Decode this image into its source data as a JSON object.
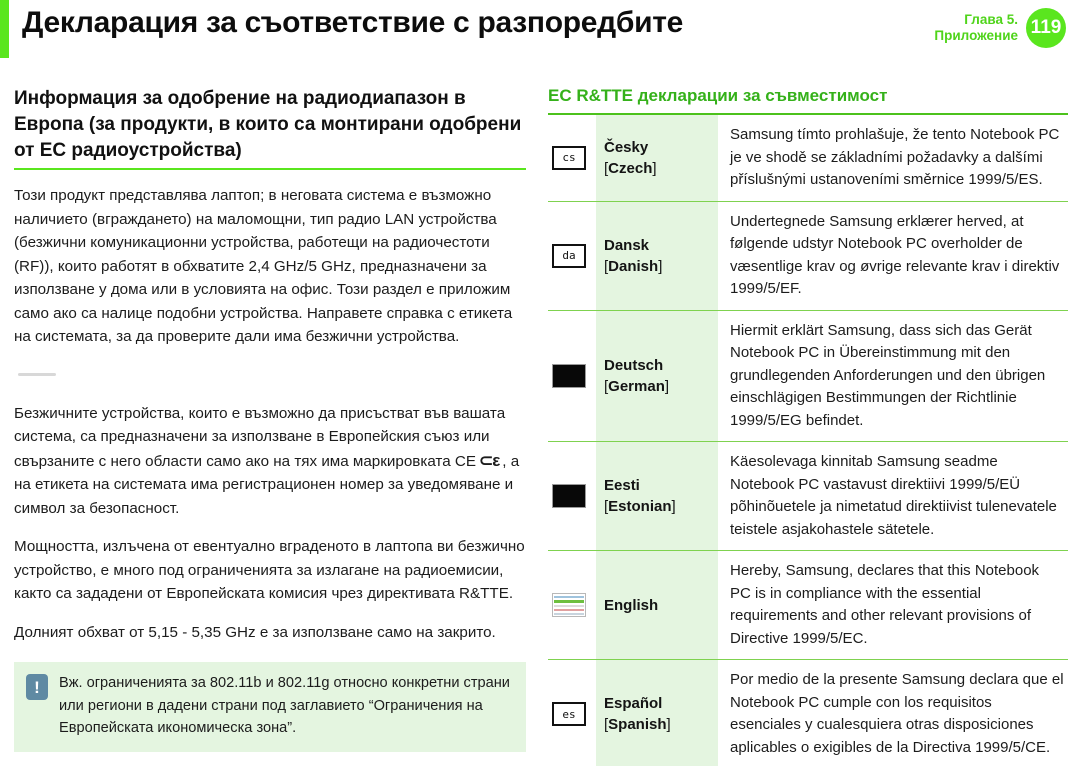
{
  "header": {
    "title": "Декларация за съответствие с разпоредбите",
    "chapter_line1": "Глава 5.",
    "chapter_line2": "Приложение",
    "page_number": "119",
    "accent_color": "#5ae61e"
  },
  "left": {
    "heading": "Информация за одобрение на радиодиапазон в Европа (за продукти, в които са монтирани одобрени от ЕС радиоустройства)",
    "p1": "Този продукт представлява лаптоп; в неговата система е възможно наличието (вграждането) на маломощни, тип радио LAN устройства (безжични комуникационни устройства, работещи на радиочестоти (RF)), които работят в обхватите 2,4 GHz/5 GHz, предназначени за използване у дома или в условията на офис. Този раздел е приложим само ако са налице подобни устройства. Направете справка с етикета на системата, за да проверите дали има безжични устройства.",
    "p2_before_ce": "Безжичните устройства, които е възможно да присъстват във вашата система, са предназначени за използване в Европейския съюз или свързаните с него области само ако на тях има маркировката CE",
    "ce_symbol": "CE",
    "p2_after_ce": ", а на етикета на системата има регистрационен номер за уведомяване и символ за безопасност.",
    "p3": "Мощността, излъчена от евентуално вграденото в лаптопа ви безжично устройство, е много под ограниченията за излагане на радиоемисии, както са зададени от Европейската комисия чрез директивата R&TTE.",
    "p4": "Долният обхват от 5,15 - 5,35 GHz е за използване само на закрито.",
    "note": {
      "icon": "!",
      "text": "Вж. ограниченията за 802.11b и 802.11g относно конкретни страни или региони в дадени страни под заглавието “Ограничения на Европейската икономическа зона”."
    }
  },
  "right": {
    "heading": "EC R&TTE декларации за съвместимост",
    "heading_color": "#35b11a",
    "rows": [
      {
        "flag_kind": "code",
        "flag_code": "cs",
        "flag_icon_name": "flag-icon-czech",
        "native": "Česky",
        "bracket_open": "[",
        "bracket_name": "Czech",
        "bracket_close": "]",
        "declaration": "Samsung tímto prohlašuje, že tento Notebook PC je ve shodě se základními požadavky a dalšími příslušnými ustanoveními směrnice 1999/5/ES."
      },
      {
        "flag_kind": "code",
        "flag_code": "da",
        "flag_icon_name": "flag-icon-danish",
        "native": "Dansk",
        "bracket_open": "[",
        "bracket_name": "Danish",
        "bracket_close": "]",
        "declaration": "Undertegnede Samsung erklærer herved, at følgende udstyr Notebook PC overholder de væsentlige krav og øvrige relevante krav i direktiv 1999/5/EF."
      },
      {
        "flag_kind": "dark",
        "flag_code": "",
        "flag_icon_name": "flag-icon-german",
        "native": "Deutsch",
        "bracket_open": "[",
        "bracket_name": "German",
        "bracket_close": "]",
        "declaration": "Hiermit erklärt Samsung, dass sich das Gerät Notebook PC in Übereinstimmung mit den grundlegenden Anforderungen und den übrigen einschlägigen Bestimmungen der Richtlinie 1999/5/EG befindet."
      },
      {
        "flag_kind": "dark",
        "flag_code": "",
        "flag_icon_name": "flag-icon-estonian",
        "native": "Eesti",
        "bracket_open": "[",
        "bracket_name": "Estonian",
        "bracket_close": "]",
        "declaration": "Käesolevaga kinnitab Samsung seadme Notebook PC vastavust direktiivi 1999/5/EÜ põhinõuetele ja nimetatud direktiivist tulenevatele teistele asjakohastele sätetele."
      },
      {
        "flag_kind": "thumb",
        "flag_code": "",
        "flag_icon_name": "flag-icon-english",
        "native": "English",
        "bracket_open": "",
        "bracket_name": "",
        "bracket_close": "",
        "declaration": "Hereby, Samsung, declares that this Notebook PC is in compliance with the essential requirements and other relevant provisions of Directive 1999/5/EC."
      },
      {
        "flag_kind": "code",
        "flag_code": "es",
        "flag_icon_name": "flag-icon-spanish",
        "native": "Español",
        "bracket_open": "[",
        "bracket_name": "Spanish",
        "bracket_close": "]",
        "declaration": "Por medio de la presente Samsung declara que el Notebook PC cumple con los requisitos esenciales y cualesquiera otras disposiciones aplicables o exigibles de la Directiva 1999/5/CE."
      }
    ]
  }
}
